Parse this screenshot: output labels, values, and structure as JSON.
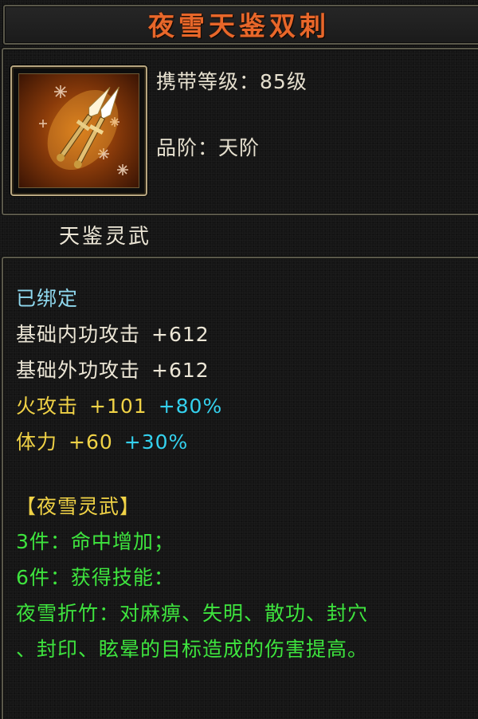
{
  "item": {
    "name": "夜雪天鉴双刺",
    "carry_level_label": "携带等级：",
    "carry_level_value": "85级",
    "grade_label": "品阶：",
    "grade_value": "天阶",
    "subtitle": "天鉴灵武",
    "icon": "twin-daggers-icon"
  },
  "description": {
    "bound": "已绑定",
    "stats": [
      {
        "name": "基础内功攻击",
        "value": "+612"
      },
      {
        "name": "基础外功攻击",
        "value": "+612"
      },
      {
        "name": "火攻击",
        "value": "+101",
        "bonus": "+80%"
      },
      {
        "name": "体力",
        "value": "+60",
        "bonus": "+30%"
      }
    ],
    "set_name": "【夜雪灵武】",
    "set_bonus_3": "3件：命中增加；",
    "set_bonus_6": "6件：获得技能：",
    "skill_line_1": "夜雪折竹：对麻痹、失明、散功、封穴",
    "skill_line_2": "、封印、眩晕的目标造成的伤害提高。"
  },
  "colors": {
    "title": "#e8672a",
    "bound": "#8fd8ee",
    "base_stat": "#ece6d6",
    "attr_stat": "#f0d246",
    "percent_bonus": "#34d1ee",
    "set_text": "#3ee43e",
    "frame": "#5a584a"
  }
}
